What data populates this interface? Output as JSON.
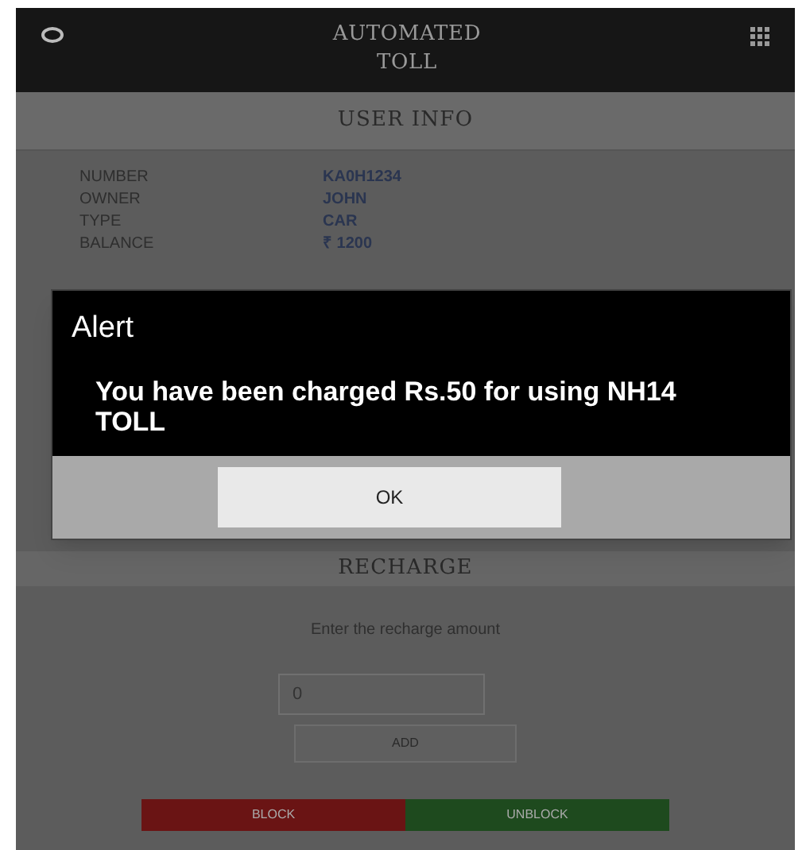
{
  "header": {
    "title": "AUTOMATED TOLL"
  },
  "user_info": {
    "heading": "USER INFO",
    "rows": [
      {
        "label": "NUMBER",
        "value": "KA0H1234"
      },
      {
        "label": "OWNER",
        "value": "JOHN"
      },
      {
        "label": "TYPE",
        "value": "CAR"
      },
      {
        "label": "BALANCE",
        "value": "₹ 1200"
      }
    ]
  },
  "recharge": {
    "heading": "RECHARGE",
    "prompt": "Enter the recharge amount",
    "amount": "0",
    "add_button": "ADD"
  },
  "actions": [
    {
      "label": "BLOCK",
      "kind": "danger"
    },
    {
      "label": "UNBLOCK",
      "kind": "safe"
    }
  ],
  "dialog": {
    "title": "Alert",
    "message": "You have been charged Rs.50 for using NH14 TOLL",
    "button": "OK"
  }
}
